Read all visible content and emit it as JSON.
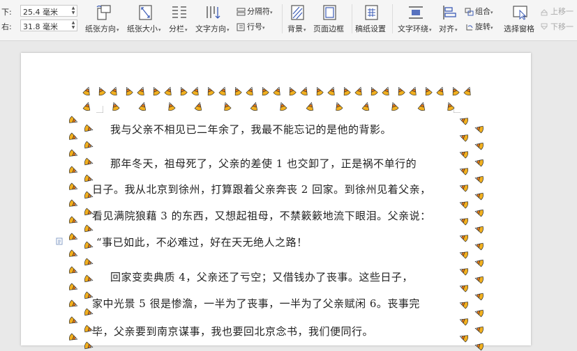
{
  "ribbon": {
    "margins": [
      {
        "label": "下:",
        "value": "25.4 毫米"
      },
      {
        "label": "右:",
        "value": "31.8 毫米"
      }
    ],
    "buttons": {
      "paper_orientation": "纸张方向",
      "paper_size": "纸张大小",
      "columns": "分栏",
      "text_direction": "文字方向",
      "separator": "分隔符",
      "line_number": "行号",
      "background": "背景",
      "page_border": "页面边框",
      "manuscript": "稿纸设置",
      "text_wrap": "文字环绕",
      "align": "对齐",
      "group": "组合",
      "rotate": "旋转",
      "selection_pane": "选择窗格",
      "move_up": "上移一",
      "move_down": "下移一"
    }
  },
  "document": {
    "lines": [
      "我与父亲不相见已二年余了，我最不能忘记的是他的背影。",
      "那年冬天，祖母死了，父亲的差使 1 也交卸了，正是祸不单行的",
      "日子。我从北京到徐州，打算跟着父亲奔丧 2 回家。到徐州见着父亲，",
      "看见满院狼藉 3 的东西，又想起祖母，不禁簌簌地流下眼泪。父亲说：",
      "“事已如此，不必难过，好在天无绝人之路！",
      "回家变卖典质 4，父亲还了亏空；又借钱办了丧事。这些日子，",
      "家中光景 5 很是惨澹，一半为了丧事，一半为了父亲赋闲 6。丧事完",
      "毕，父亲要到南京谋事，我也要回北京念书，我们便同行。"
    ]
  },
  "colors": {
    "accent": "#3b5bb5",
    "candy_yellow": "#f2b01e",
    "candy_orange": "#f07a10",
    "candy_white": "#ffffff"
  }
}
